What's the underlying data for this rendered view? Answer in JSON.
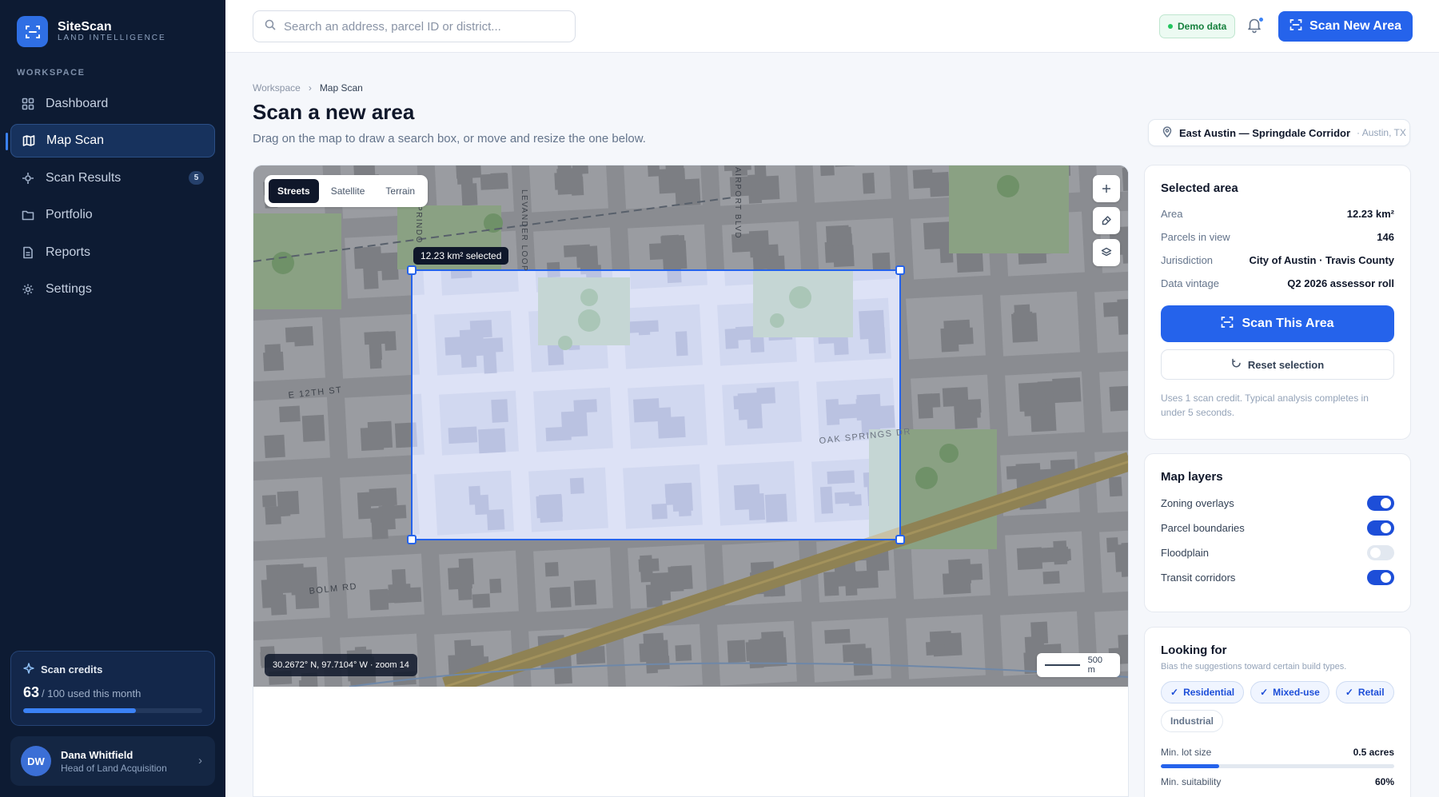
{
  "brand": {
    "name": "SiteScan",
    "tagline": "LAND INTELLIGENCE"
  },
  "sidebar": {
    "section_label": "WORKSPACE",
    "items": [
      {
        "label": "Dashboard",
        "icon": "grid-icon"
      },
      {
        "label": "Map Scan",
        "icon": "map-icon",
        "active": true
      },
      {
        "label": "Scan Results",
        "icon": "crosshair-icon",
        "badge": "5"
      },
      {
        "label": "Portfolio",
        "icon": "folder-icon"
      },
      {
        "label": "Reports",
        "icon": "document-icon"
      },
      {
        "label": "Settings",
        "icon": "gear-icon"
      }
    ],
    "credits": {
      "title": "Scan credits",
      "used": "63",
      "suffix": "/ 100 used this month",
      "fraction": 0.63
    },
    "user": {
      "initials": "DW",
      "name": "Dana Whitfield",
      "role": "Head of Land Acquisition"
    }
  },
  "topbar": {
    "search_placeholder": "Search an address, parcel ID or district...",
    "demo_label": "Demo data",
    "new_scan_label": "Scan New Area"
  },
  "page": {
    "breadcrumb": [
      "Workspace",
      "Map Scan"
    ],
    "title": "Scan a new area",
    "subtitle": "Drag on the map to draw a search box, or move and resize the one below.",
    "location": {
      "name": "East Austin — Springdale Corridor",
      "city": "· Austin, TX"
    }
  },
  "map": {
    "tabs": [
      "Streets",
      "Satellite",
      "Terrain"
    ],
    "active_tab": "Streets",
    "selection_label": "12.23 km² selected",
    "coords": "30.2672° N, 97.7104° W · zoom 14",
    "scale": "500 m",
    "street_labels": [
      "E 12TH ST",
      "OAK SPRINGS DR",
      "BOLM RD",
      "LEVANDER LOOP",
      "AIRPORT BLVD",
      "PRINDO RD"
    ]
  },
  "selected_area": {
    "title": "Selected area",
    "rows": [
      {
        "k": "Area",
        "v": "12.23 km²"
      },
      {
        "k": "Parcels in view",
        "v": "146"
      },
      {
        "k": "Jurisdiction",
        "v": "City of Austin · Travis County"
      },
      {
        "k": "Data vintage",
        "v": "Q2 2026 assessor roll"
      }
    ],
    "scan_button": "Scan This Area",
    "reset_button": "Reset selection",
    "note": "Uses 1 scan credit. Typical analysis completes in under 5 seconds."
  },
  "layers": {
    "title": "Map layers",
    "items": [
      {
        "label": "Zoning overlays",
        "on": true
      },
      {
        "label": "Parcel boundaries",
        "on": true
      },
      {
        "label": "Floodplain",
        "on": false
      },
      {
        "label": "Transit corridors",
        "on": true
      }
    ]
  },
  "looking_for": {
    "title": "Looking for",
    "subtitle": "Bias the suggestions toward certain build types.",
    "chips": [
      {
        "label": "Residential",
        "on": true
      },
      {
        "label": "Mixed-use",
        "on": true
      },
      {
        "label": "Retail",
        "on": true
      },
      {
        "label": "Industrial",
        "on": false
      }
    ],
    "min_lot": {
      "label": "Min. lot size",
      "value": "0.5 acres",
      "fraction": 0.25
    },
    "min_suit": {
      "label": "Min. suitability",
      "value": "60%",
      "fraction": 0.6
    }
  },
  "colors": {
    "accent": "#2563eb",
    "sidebar": "#0d1b33",
    "road": "#b59a54",
    "park": "#cfe3c8"
  }
}
